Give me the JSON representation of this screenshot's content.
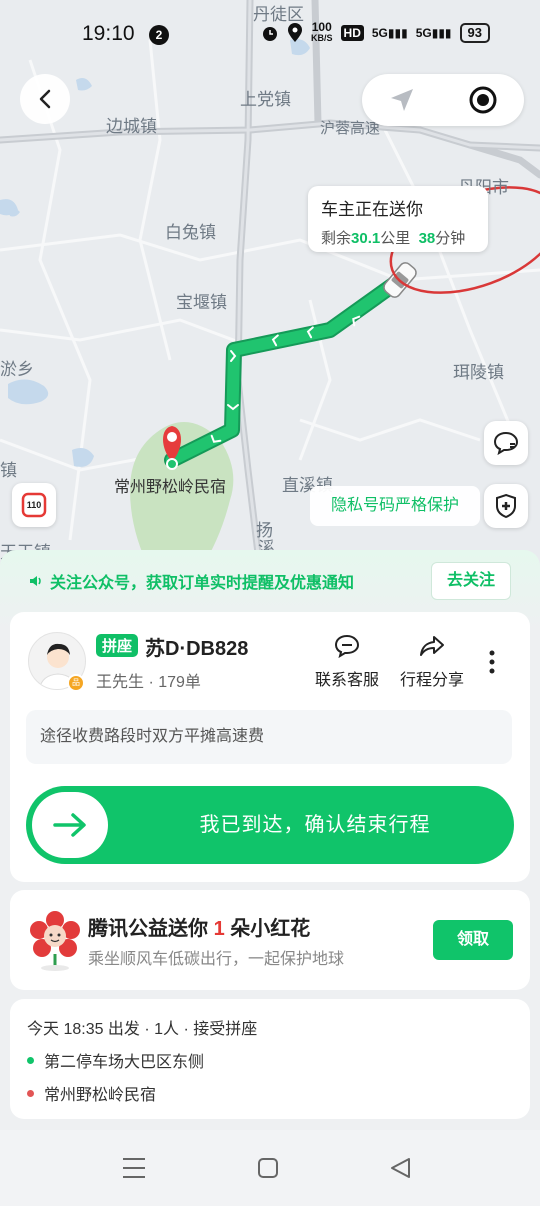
{
  "status_bar": {
    "time": "19:10",
    "notification_count": "2",
    "net_speed_value": "100",
    "net_speed_unit": "KB/S",
    "hd_label": "HD",
    "sig1": "5G",
    "sig2": "5G",
    "battery": "93"
  },
  "map": {
    "places": {
      "danyang_district": "丹徒区",
      "shangdang": "上党镇",
      "biancheng": "边城镇",
      "hurong": "沪蓉高速",
      "danyang_city": "丹阳市",
      "baitu": "白兔镇",
      "baoyan": "宝堰镇",
      "xuxiang": "淤乡",
      "lingling": "珥陵镇",
      "zhen": "镇",
      "zhixi": "直溪镇",
      "tianwang": "天王镇",
      "yang": "扬",
      "xi": "溪"
    },
    "destination_label": "常州野松岭民宿",
    "bubble_title": "车主正在送你",
    "bubble_prefix": "剩余",
    "distance_value": "30.1",
    "distance_unit": "公里",
    "time_value": "38",
    "time_unit": "分钟",
    "privacy_text": "隐私号码严格保护",
    "speed_limit": "110",
    "icons": {
      "back": "back-arrow-icon",
      "locate": "navigate-arrow-icon",
      "recenter": "recenter-target-icon",
      "chat": "chat-bubble-icon",
      "shield": "shield-plus-icon"
    }
  },
  "follow_bar": {
    "text": "关注公众号，获取订单实时提醒及优惠通知",
    "button": "去关注"
  },
  "driver": {
    "tag": "拼座",
    "plate": "苏D·DB828",
    "name_line": "王先生 · 179单",
    "badge": "品质",
    "actions": [
      {
        "label": "联系客服"
      },
      {
        "label": "行程分享"
      }
    ],
    "toll_notice": "途径收费路段时双方平摊高速费",
    "arrive_button": "我已到达，确认结束行程"
  },
  "promo": {
    "title_prefix": "腾讯公益送你 ",
    "title_count": "1",
    "title_suffix": " 朵小红花",
    "subtitle": "乘坐顺风车低碳出行，一起保护地球",
    "button": "领取"
  },
  "trip": {
    "meta": "今天 18:35 出发 · 1人 · 接受拼座",
    "pickup": "第二停车场大巴区东侧",
    "dropoff": "常州野松岭民宿",
    "pickup_color": "#10c46a",
    "dropoff_color": "#e25555"
  },
  "colors": {
    "brand_green": "#10c46a",
    "route_green": "#1cc06c",
    "red": "#e53935"
  }
}
